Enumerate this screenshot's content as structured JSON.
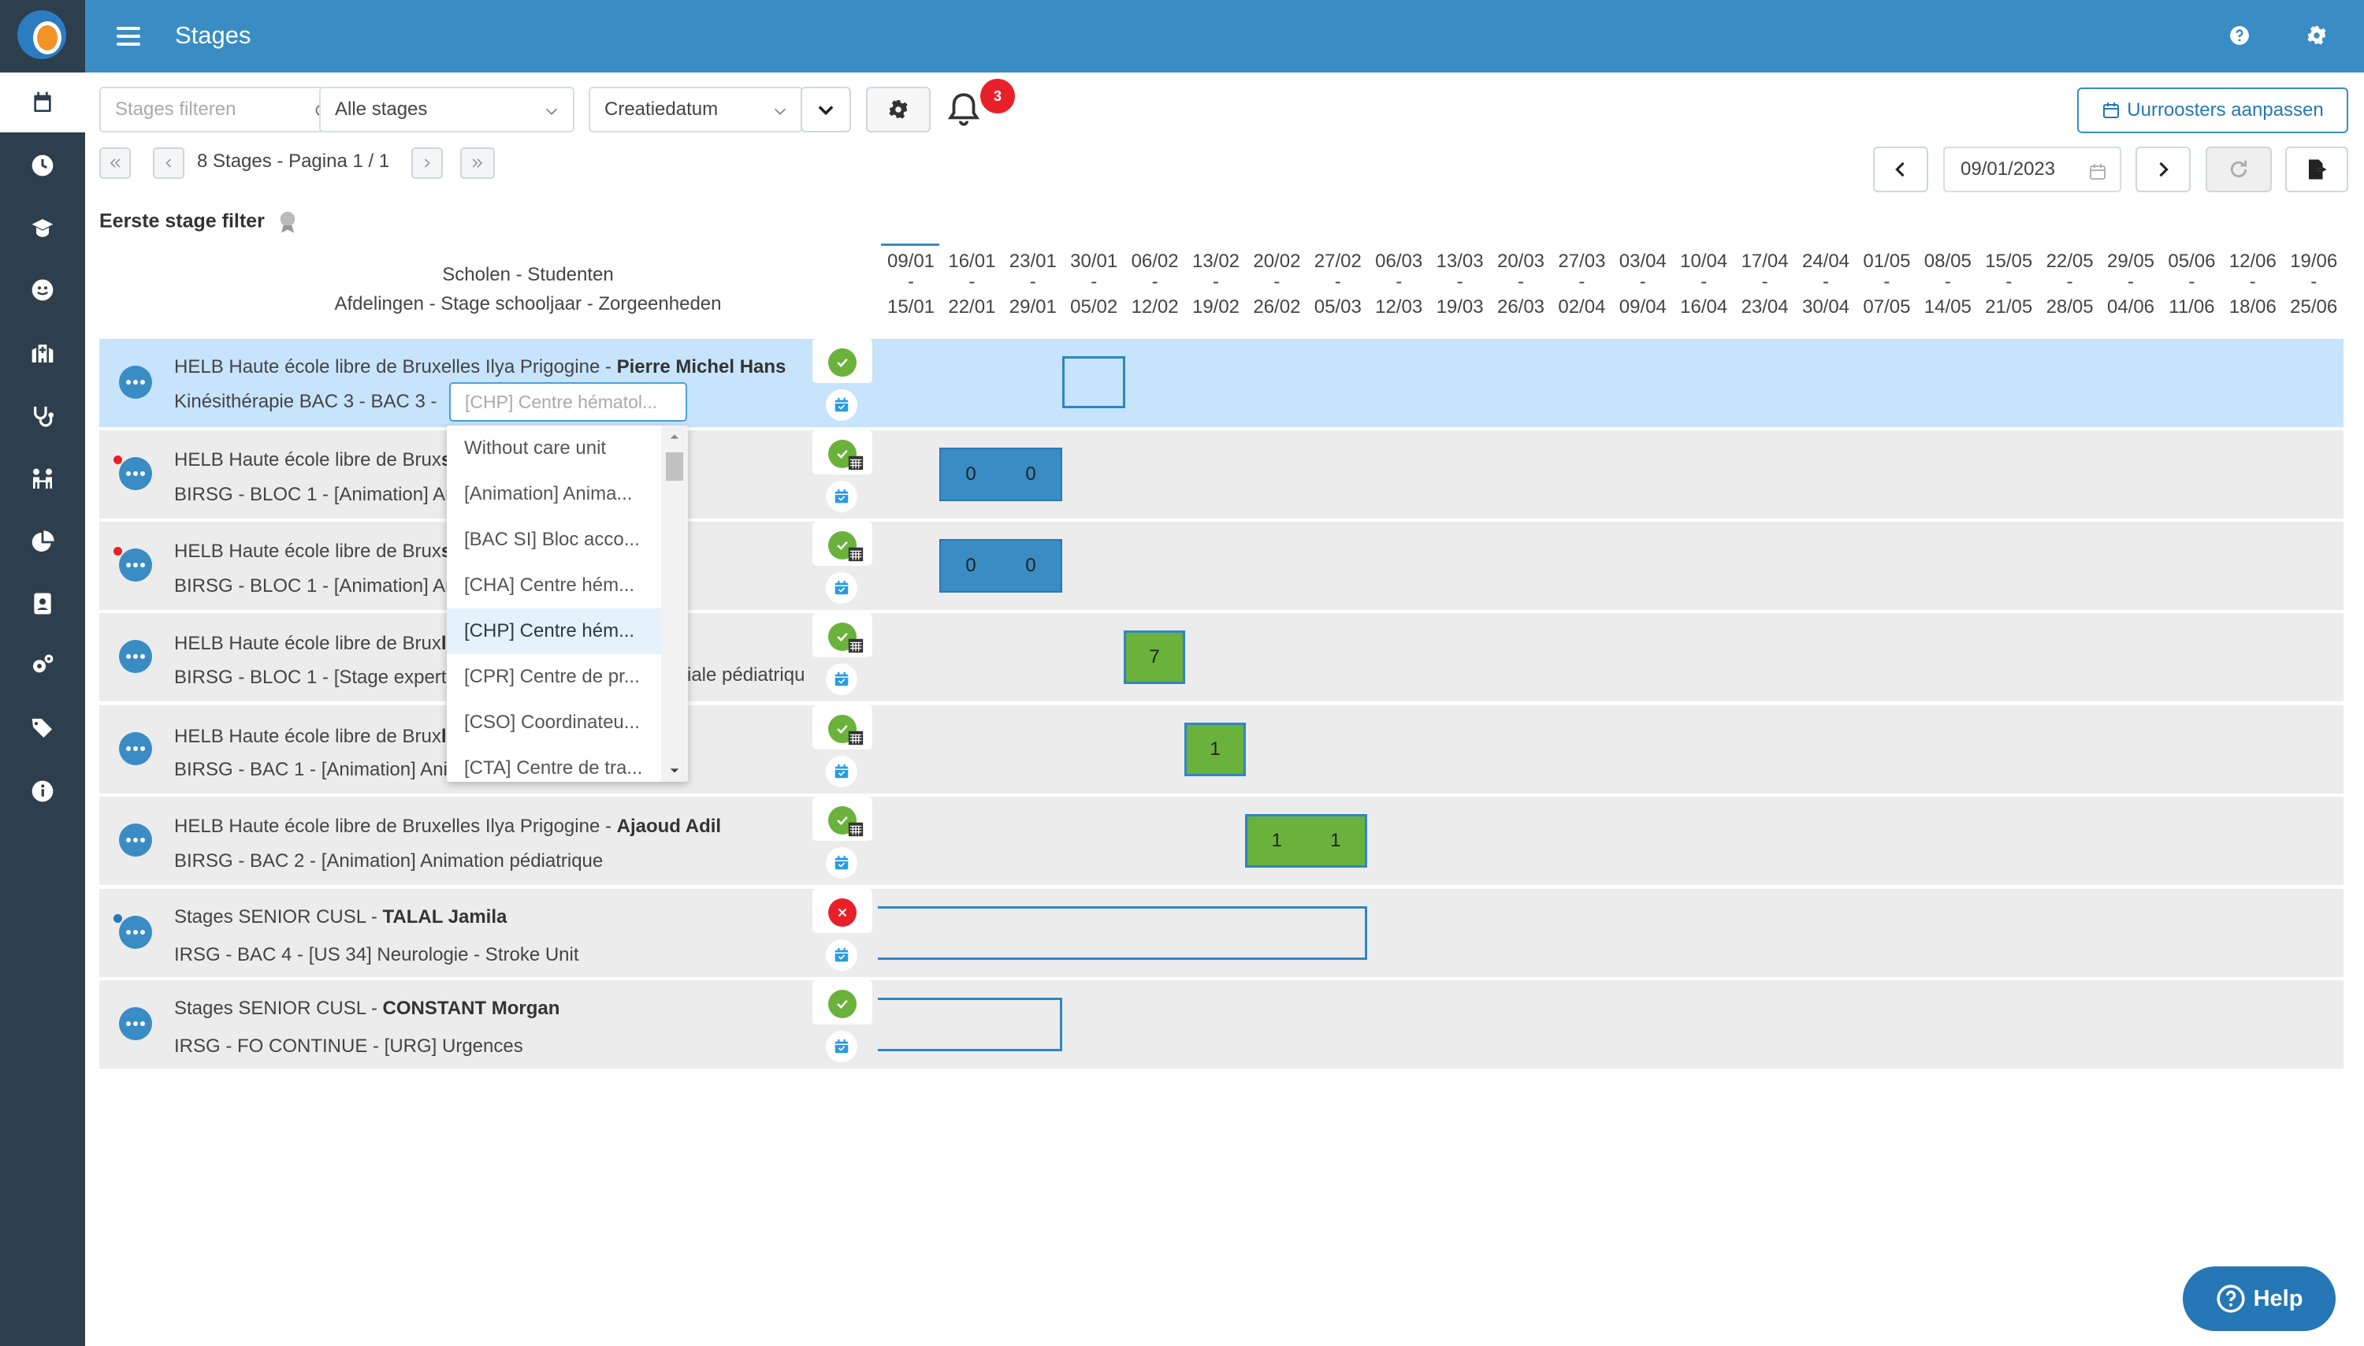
{
  "app": {
    "title": "Stages"
  },
  "toolbar": {
    "search_placeholder": "Stages filteren",
    "filter_value": "Alle stages",
    "sort_value": "Creatiedatum",
    "notification_count": "3",
    "schedule_button": "Uurroosters aanpassen",
    "date_value": "09/01/2023"
  },
  "pager": {
    "text": "8 Stages - Pagina 1 / 1"
  },
  "filter": {
    "label": "Eerste stage filter"
  },
  "headers": {
    "line1": "Scholen - Studenten",
    "line2": "Afdelingen - Stage schooljaar - Zorgeenheden"
  },
  "weeks": [
    {
      "start": "09/01",
      "end": "15/01"
    },
    {
      "start": "16/01",
      "end": "22/01"
    },
    {
      "start": "23/01",
      "end": "29/01"
    },
    {
      "start": "30/01",
      "end": "05/02"
    },
    {
      "start": "06/02",
      "end": "12/02"
    },
    {
      "start": "13/02",
      "end": "19/02"
    },
    {
      "start": "20/02",
      "end": "26/02"
    },
    {
      "start": "27/02",
      "end": "05/03"
    },
    {
      "start": "06/03",
      "end": "12/03"
    },
    {
      "start": "13/03",
      "end": "19/03"
    },
    {
      "start": "20/03",
      "end": "26/03"
    },
    {
      "start": "27/03",
      "end": "02/04"
    },
    {
      "start": "03/04",
      "end": "09/04"
    },
    {
      "start": "10/04",
      "end": "16/04"
    },
    {
      "start": "17/04",
      "end": "23/04"
    },
    {
      "start": "24/04",
      "end": "30/04"
    },
    {
      "start": "01/05",
      "end": "07/05"
    },
    {
      "start": "08/05",
      "end": "14/05"
    },
    {
      "start": "15/05",
      "end": "21/05"
    },
    {
      "start": "22/05",
      "end": "28/05"
    },
    {
      "start": "29/05",
      "end": "04/06"
    },
    {
      "start": "05/06",
      "end": "11/06"
    },
    {
      "start": "12/06",
      "end": "18/06"
    },
    {
      "start": "19/06",
      "end": "25/06"
    }
  ],
  "week_separator": "-",
  "rows": [
    {
      "school": "HELB Haute école libre de Bruxelles Ilya Prigogine - ",
      "student": "Pierre Michel Hans",
      "detail": "Kinésithérapie BAC 3 - BAC 3 - ",
      "status": "ok",
      "status_color": "#6ab23b"
    },
    {
      "school": "HELB Haute école libre de Brux",
      "student": "st",
      "detail": "BIRSG - BLOC 1 - [Animation] An",
      "status": "ok-calendar",
      "status_color": "#6ab23b",
      "blocks": [
        "0",
        "0"
      ]
    },
    {
      "school": "HELB Haute école libre de Brux",
      "student": "st",
      "detail": "BIRSG - BLOC 1 - [Animation] An",
      "status": "ok-calendar",
      "status_color": "#6ab23b",
      "blocks": [
        "0",
        "0"
      ]
    },
    {
      "school": "HELB Haute école libre de Brux",
      "student": "l Adil",
      "detail": "BIRSG - BLOC 1 - [Stage experti",
      "detail_tail": "iale pédiatriqu",
      "status": "ok-calendar",
      "status_color": "#6ab23b",
      "blocks": [
        "7"
      ]
    },
    {
      "school": "HELB Haute école libre de Brux",
      "student": "l Adil",
      "detail": "BIRSG - BAC 1 - [Animation] Ani",
      "status": "ok-calendar",
      "status_color": "#6ab23b",
      "blocks": [
        "1"
      ]
    },
    {
      "school": "HELB Haute école libre de Bruxelles Ilya Prigogine - ",
      "student": "Ajaoud Adil",
      "detail": "BIRSG - BAC 2 - [Animation] Animation pédiatrique",
      "status": "ok-calendar",
      "status_color": "#6ab23b",
      "blocks": [
        "1",
        "1"
      ]
    },
    {
      "school": "Stages SENIOR CUSL - ",
      "student": "TALAL Jamila",
      "detail": "IRSG - BAC 4 - [US 34] Neurologie - Stroke Unit",
      "status": "error",
      "status_color": "#e8202a"
    },
    {
      "school": "Stages SENIOR CUSL - ",
      "student": "CONSTANT Morgan",
      "detail": "IRSG - FO CONTINUE - [URG] Urgences",
      "status": "ok",
      "status_color": "#6ab23b"
    }
  ],
  "care_unit": {
    "input_placeholder": "[CHP] Centre hématol...",
    "options": [
      "Without care unit",
      "[Animation] Anima...",
      "[BAC SI] Bloc acco...",
      "[CHA] Centre hém...",
      "[CHP] Centre hém...",
      "[CPR] Centre de pr...",
      "[CSO] Coordinateu...",
      "[CTA] Centre de tra..."
    ],
    "highlighted_option": "[CHP] Centre hém..."
  },
  "help": {
    "label": "Help"
  },
  "colors": {
    "primary": "#3a8cc4",
    "sidebar": "#2d3e4c",
    "block_green": "#6ab23b",
    "selected_row": "#c7e4fc",
    "row_bg": "#ececec"
  }
}
